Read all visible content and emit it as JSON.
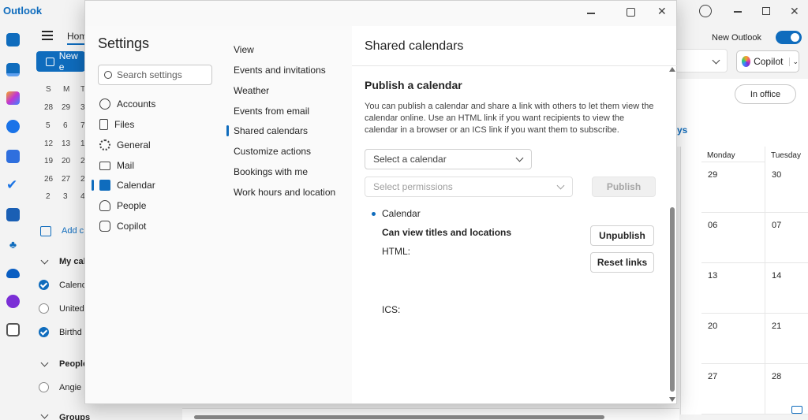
{
  "app": {
    "title": "Outlook"
  },
  "background": {
    "home_tab": "Hom",
    "new_event": "New e",
    "new_outlook_label": "New Outlook",
    "copilot_label": "Copilot",
    "in_office": "In office",
    "days_partial": "ys",
    "mini_cal_days": [
      "S",
      "M",
      "T"
    ],
    "mini_cal_rows": [
      [
        "28",
        "29",
        "3"
      ],
      [
        "5",
        "6",
        "7"
      ],
      [
        "12",
        "13",
        "1"
      ],
      [
        "19",
        "20",
        "2"
      ],
      [
        "26",
        "27",
        "2"
      ],
      [
        "2",
        "3",
        "4"
      ]
    ],
    "add_calendar": "Add c",
    "my_calendars": "My cal",
    "calendars": [
      {
        "label": "Calend",
        "checked": true
      },
      {
        "label": "United",
        "checked": false
      },
      {
        "label": "Birthd",
        "checked": true
      }
    ],
    "people_group": "People",
    "people_items": [
      {
        "label": "Angie",
        "checked": false
      }
    ],
    "groups_label": "Groups",
    "grid_headers": [
      "Monday",
      "Tuesday"
    ],
    "grid_rows": [
      [
        "29",
        "30"
      ],
      [
        "06",
        "07"
      ],
      [
        "13",
        "14"
      ],
      [
        "20",
        "21"
      ],
      [
        "27",
        "28"
      ]
    ]
  },
  "settings": {
    "title": "Settings",
    "search_placeholder": "Search settings",
    "nav": [
      {
        "label": "Accounts",
        "icon": "person-icon"
      },
      {
        "label": "Files",
        "icon": "file-icon"
      },
      {
        "label": "General",
        "icon": "gear-icon"
      },
      {
        "label": "Mail",
        "icon": "mail-icon"
      },
      {
        "label": "Calendar",
        "icon": "calendar-icon",
        "selected": true
      },
      {
        "label": "People",
        "icon": "people-icon"
      },
      {
        "label": "Copilot",
        "icon": "copilot-icon"
      }
    ],
    "subnav": [
      {
        "label": "View"
      },
      {
        "label": "Events and invitations"
      },
      {
        "label": "Weather"
      },
      {
        "label": "Events from email"
      },
      {
        "label": "Shared calendars",
        "selected": true
      },
      {
        "label": "Customize actions"
      },
      {
        "label": "Bookings with me"
      },
      {
        "label": "Work hours and location"
      }
    ]
  },
  "content": {
    "title": "Shared calendars",
    "section_title": "Publish a calendar",
    "description": "You can publish a calendar and share a link with others to let them view the calendar online. Use an HTML link if you want recipients to view the calendar in a browser or an ICS link if you want them to subscribe.",
    "select_calendar": "Select a calendar",
    "select_permissions": "Select permissions",
    "publish_button": "Publish",
    "published_calendar": "Calendar",
    "permission_label": "Can view titles and locations",
    "html_label": "HTML:",
    "ics_label": "ICS:",
    "unpublish_button": "Unpublish",
    "reset_links_button": "Reset links"
  },
  "colors": {
    "accent": "#0f6cbd",
    "toggle_on": "#0f6cbd"
  }
}
